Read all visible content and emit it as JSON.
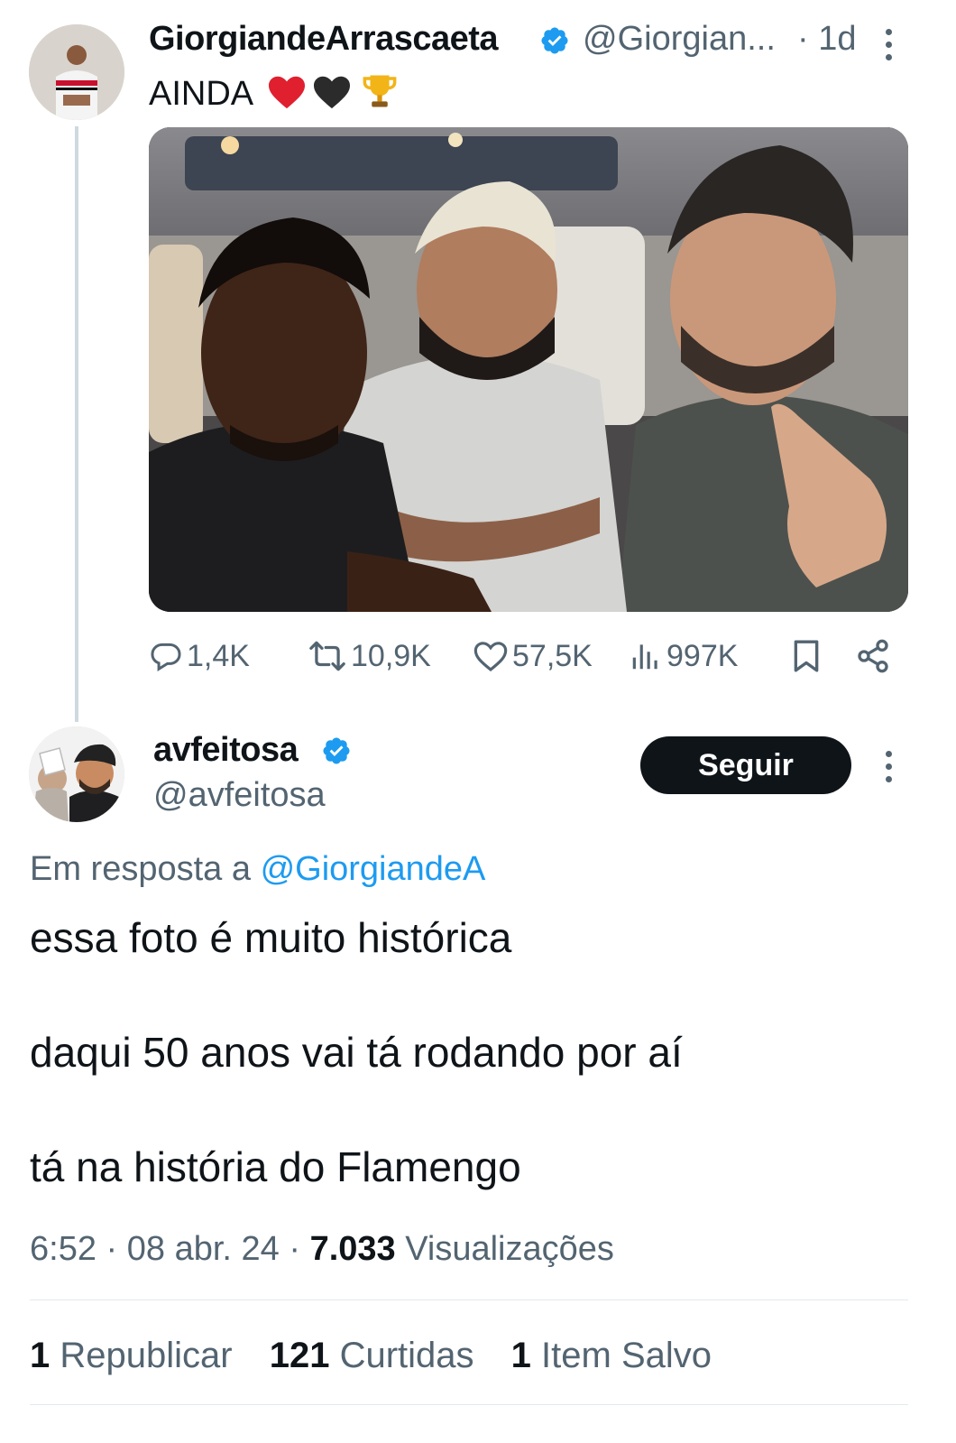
{
  "tweet1": {
    "display_name": "GiorgiandeArrascaeta",
    "handle": "@Giorgian...",
    "time": "· 1d",
    "text": "AINDA",
    "emojis": [
      "red-heart",
      "black-heart",
      "trophy"
    ],
    "actions": {
      "replies": "1,4K",
      "retweets": "10,9K",
      "likes": "57,5K",
      "views": "997K"
    }
  },
  "tweet2": {
    "display_name": "avfeitosa",
    "handle": "@avfeitosa",
    "follow_label": "Seguir",
    "reply_prefix": "Em resposta a",
    "reply_to": "@GiorgiandeA",
    "lines": [
      "essa foto é muito histórica",
      "daqui 50 anos vai tá rodando por aí",
      "tá na história do Flamengo"
    ],
    "time": "6:52",
    "date": "08 abr. 24",
    "views_count": "7.033",
    "views_label": "Visualizações",
    "stats": [
      {
        "count": "1",
        "label": "Republicar"
      },
      {
        "count": "121",
        "label": "Curtidas"
      },
      {
        "count": "1",
        "label": "Item Salvo"
      }
    ]
  },
  "colors": {
    "text": "#0f1419",
    "secondary": "#536471",
    "link": "#1d9bf0",
    "verified": "#1d9bf0",
    "follow_bg": "#0f1419"
  }
}
